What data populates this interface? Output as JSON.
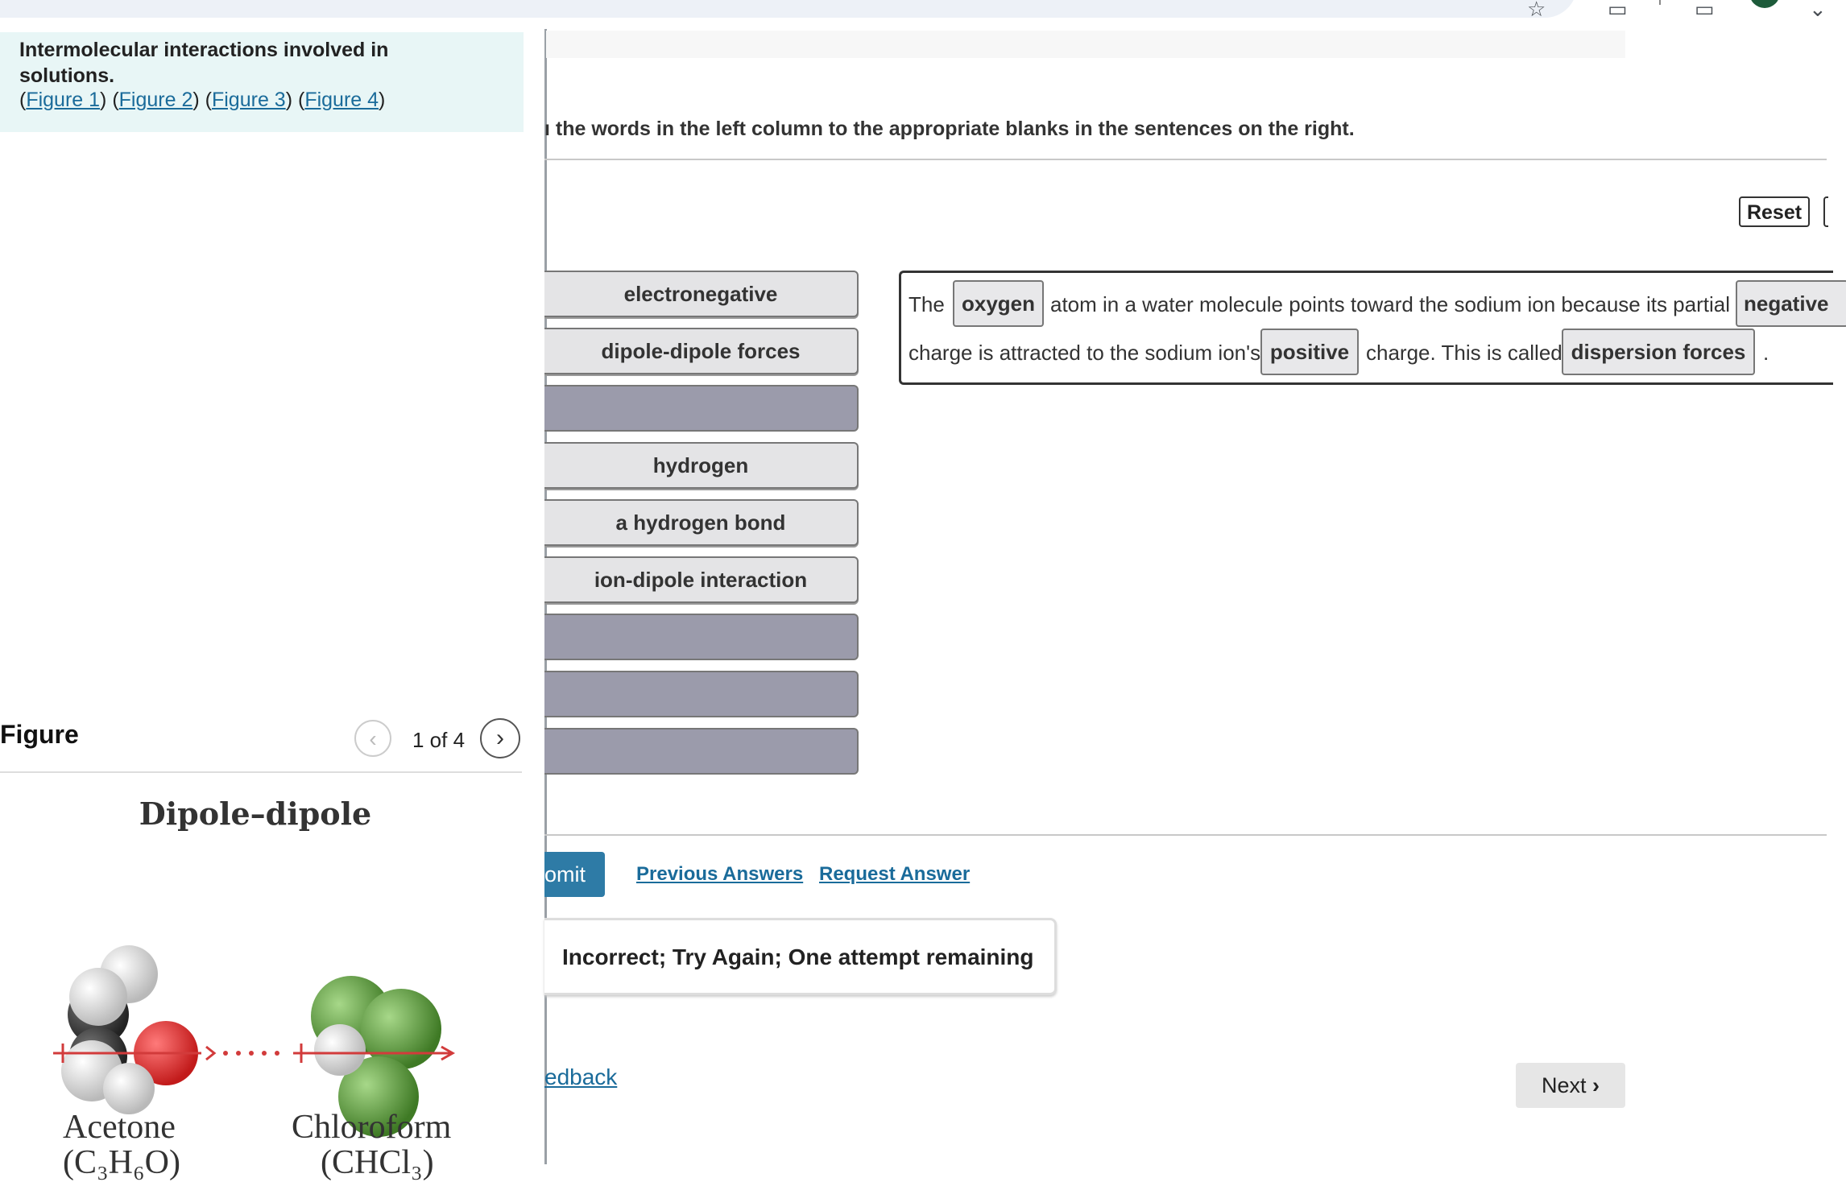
{
  "intro": {
    "title": "Intermolecular interactions involved in solutions.",
    "links": [
      "Figure 1",
      "Figure 2",
      "Figure 3",
      "Figure 4"
    ]
  },
  "figure": {
    "heading": "Figure",
    "counter": "1 of 4",
    "title": "Dipole–dipole",
    "label_left": "Acetone",
    "label_right": "Chloroform",
    "formula_left": "(C₃H₆O)",
    "formula_right": "(CHCl₃)"
  },
  "instructions": "ı the words in the left column to the appropriate blanks in the sentences on the right.",
  "reset_label": "Reset",
  "tiles": [
    {
      "label": "electronegative"
    },
    {
      "label": "dipole-dipole forces"
    },
    {
      "label": ""
    },
    {
      "label": "hydrogen"
    },
    {
      "label": "a hydrogen bond"
    },
    {
      "label": "ion-dipole interaction"
    },
    {
      "label": ""
    },
    {
      "label": ""
    },
    {
      "label": ""
    }
  ],
  "sentence": {
    "t1": "The",
    "blank1": "oxygen",
    "t2": "atom in a water molecule points toward the sodium ion because its partial",
    "blank2": "negative",
    "t3": "charge is attracted to the sodium ion's",
    "blank3": "positive",
    "t4": "charge. This is called",
    "blank4": "dispersion forces",
    "t5": "."
  },
  "actions": {
    "submit_label": "omit",
    "previous_answers": "Previous Answers",
    "request_answer": "Request Answer"
  },
  "feedback_message": "Incorrect; Try Again; One attempt remaining",
  "feedback_link": "edback",
  "next_label": "Next"
}
